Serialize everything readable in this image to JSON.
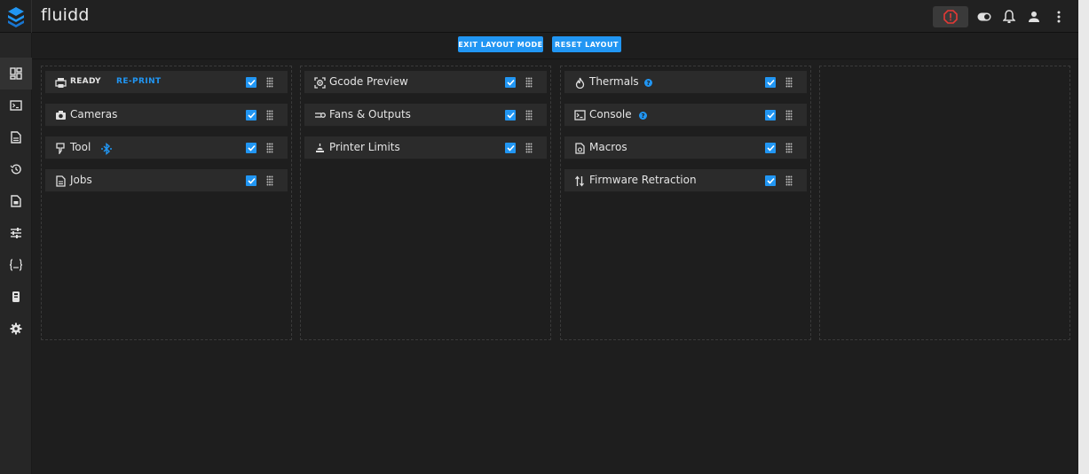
{
  "app": {
    "title": "fluidd"
  },
  "layout_buttons": {
    "exit": "EXIT LAYOUT MODE",
    "reset": "RESET LAYOUT"
  },
  "columns": [
    {
      "cards": [
        {
          "label": "READY",
          "extra": "RE-PRINT",
          "icon": "printer-icon"
        },
        {
          "label": "Cameras",
          "icon": "camera-icon"
        },
        {
          "label": "Tool",
          "icon": "tool-icon",
          "badge_icon": "bluetooth-icon"
        },
        {
          "label": "Jobs",
          "icon": "file-icon"
        }
      ]
    },
    {
      "cards": [
        {
          "label": "Gcode Preview",
          "icon": "gcode-preview-icon"
        },
        {
          "label": "Fans & Outputs",
          "icon": "fan-icon"
        },
        {
          "label": "Printer Limits",
          "icon": "limits-icon"
        }
      ]
    },
    {
      "cards": [
        {
          "label": "Thermals",
          "icon": "fire-icon",
          "help": "?"
        },
        {
          "label": "Console",
          "icon": "console-icon",
          "help": "?"
        },
        {
          "label": "Macros",
          "icon": "macros-icon"
        },
        {
          "label": "Firmware Retraction",
          "icon": "retraction-icon"
        }
      ]
    }
  ],
  "colors": {
    "accent": "#2196f3",
    "estop": "#e53935"
  }
}
